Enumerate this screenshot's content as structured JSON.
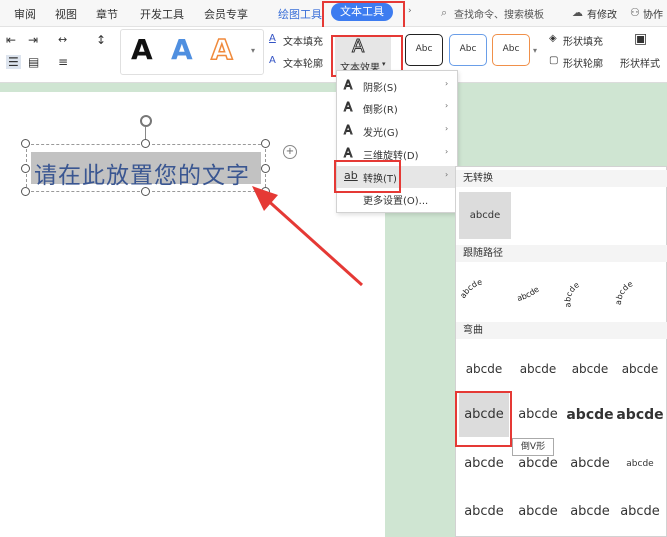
{
  "tabs": [
    "审阅",
    "视图",
    "章节",
    "开发工具",
    "会员专享",
    "绘图工具",
    "文本工具"
  ],
  "search": "查找命令、搜索模板",
  "top_right": {
    "modified": "有修改",
    "collab": "协作"
  },
  "ribbon": {
    "presets_large": [
      "A",
      "A",
      "A"
    ],
    "text_fill": "文本填充",
    "text_outline": "文本轮廓",
    "text_effects": "文本效果",
    "presets_small": [
      "Abc",
      "Abc",
      "Abc"
    ],
    "shape_fill": "形状填充",
    "shape_outline": "形状轮廓",
    "shape_style": "形状样式"
  },
  "textbox_text": "请在此放置您的文字",
  "menu": {
    "items": [
      {
        "label": "阴影(S)",
        "icon": "A"
      },
      {
        "label": "倒影(R)",
        "icon": "A"
      },
      {
        "label": "发光(G)",
        "icon": "A"
      },
      {
        "label": "三维旋转(D)",
        "icon": "A"
      },
      {
        "label": "转换(T)",
        "icon": "ab"
      },
      {
        "label": "更多设置(O)...",
        "icon": ""
      }
    ]
  },
  "submenu": {
    "no_transform": "无转换",
    "follow_path": "跟随路径",
    "warp": "弯曲",
    "sample": "abcde",
    "tooltip": "倒V形"
  },
  "watermark": "Baidu经验"
}
